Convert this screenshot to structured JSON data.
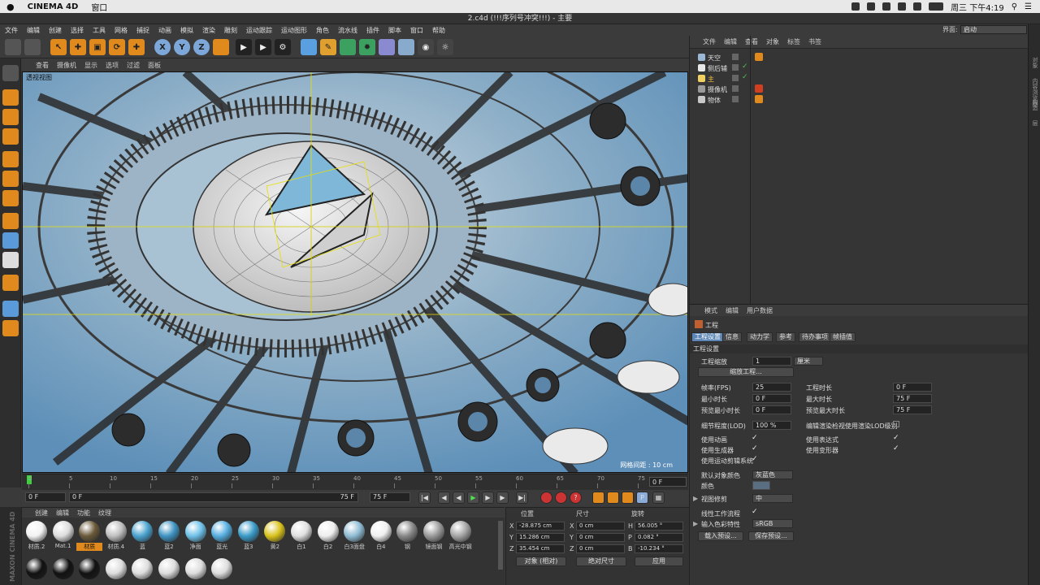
{
  "mac": {
    "app": "CINEMA 4D",
    "menu1": "窗口",
    "clock": "周三 下午4:19"
  },
  "window_title": "2.c4d (!!!序列号冲突!!!) - 主要",
  "menubar": [
    "文件",
    "编辑",
    "创建",
    "选择",
    "工具",
    "网格",
    "捕捉",
    "动画",
    "模拟",
    "渲染",
    "雕刻",
    "运动跟踪",
    "运动图形",
    "角色",
    "流水线",
    "插件",
    "脚本",
    "窗口",
    "帮助"
  ],
  "layout": {
    "label": "界面:",
    "value": "启动"
  },
  "viewport": {
    "menu": [
      "查看",
      "摄像机",
      "显示",
      "选项",
      "过滤",
      "面板"
    ],
    "label": "透视视图",
    "grid": "网格间距 : 10 cm"
  },
  "timeline": {
    "ticks": [
      "0",
      "5",
      "10",
      "15",
      "20",
      "25",
      "30",
      "35",
      "40",
      "45",
      "50",
      "55",
      "60",
      "65",
      "70",
      "75"
    ],
    "frame": "0 F"
  },
  "transport": {
    "start": "0 F",
    "slider": "0 F",
    "slider_end": "75 F",
    "end": "75 F"
  },
  "materials": {
    "menu": [
      "创建",
      "编辑",
      "功能",
      "纹理"
    ],
    "items": [
      {
        "name": "材质.2",
        "color": "#f2f2f2"
      },
      {
        "name": "Mat.1",
        "color": "#dddddd"
      },
      {
        "name": "材质",
        "color": "#6a5a3a"
      },
      {
        "name": "材质.4",
        "color": "#bfbfbf"
      },
      {
        "name": "蓝",
        "color": "#4aa3cf"
      },
      {
        "name": "蓝2",
        "color": "#3f93c2"
      },
      {
        "name": "净面",
        "color": "#6ec0e8"
      },
      {
        "name": "蓝光",
        "color": "#55aee0"
      },
      {
        "name": "蓝3",
        "color": "#3a9bc8"
      },
      {
        "name": "黄2",
        "color": "#d9c21c"
      },
      {
        "name": "白1",
        "color": "#e0e0e0"
      },
      {
        "name": "白2",
        "color": "#eeeeee"
      },
      {
        "name": "白3面盘",
        "color": "#8fbcd4"
      },
      {
        "name": "白4",
        "color": "#f0f0f0"
      },
      {
        "name": "钢",
        "color": "#888888"
      },
      {
        "name": "镜面钢",
        "color": "#9a9a9a"
      },
      {
        "name": "高光中钢",
        "color": "#a5a5a5"
      }
    ]
  },
  "coord": {
    "headers": [
      "位置",
      "尺寸",
      "旋转"
    ],
    "pos": {
      "x": "-28.875 cm",
      "y": "15.286 cm",
      "z": "35.454 cm"
    },
    "size": {
      "x": "0 cm",
      "y": "0 cm",
      "z": "0 cm"
    },
    "rot": {
      "h": "56.005 °",
      "p": "0.082 °",
      "b": "-10.234 °"
    },
    "mode": "对象 (相对)",
    "size_mode": "绝对尺寸",
    "apply": "应用"
  },
  "objects": {
    "menu": [
      "文件",
      "编辑",
      "查看",
      "对象",
      "标签",
      "书签"
    ],
    "rows": [
      {
        "name": "天空",
        "color": "#9ab8d4"
      },
      {
        "name": "侧后辅",
        "color": "#e8e8e8"
      },
      {
        "name": "主",
        "color": "#f0d060"
      },
      {
        "name": "摄像机",
        "color": "#9a9a9a"
      },
      {
        "name": "物体",
        "color": "#c8c8c8"
      }
    ]
  },
  "attr": {
    "menu": [
      "模式",
      "编辑",
      "用户数据"
    ],
    "title": "工程",
    "tabs": [
      "工程设置",
      "信息",
      "动力学",
      "参考",
      "待办事项",
      "帧插值"
    ],
    "section": "工程设置",
    "scale_label": "工程缩放",
    "scale_val": "1",
    "scale_unit": "厘米",
    "scale_btn": "缩放工程...",
    "fps_label": "帧率(FPS)",
    "fps": "25",
    "proj_time_label": "工程时长",
    "proj_time": "0 F",
    "min_time_label": "最小时长",
    "min_time": "0 F",
    "max_time_label": "最大时长",
    "max_time": "75 F",
    "prev_min_label": "预览最小时长",
    "prev_min": "0 F",
    "prev_max_label": "预览最大时长",
    "prev_max": "75 F",
    "lod_label": "细节程度(LOD)",
    "lod": "100 %",
    "lod_render_label": "编辑渲染检视使用渲染LOD级别",
    "anim_label": "使用动画",
    "expr_label": "使用表达式",
    "gen_label": "使用生成器",
    "deform_label": "使用变形器",
    "motion_label": "使用运动剪辑系统",
    "defcolor_label": "默认对象颜色",
    "defcolor": "灰蓝色",
    "color_label": "颜色",
    "clip_label": "视图修剪",
    "clip": "中",
    "linear_label": "线性工作流程",
    "colorprofile_label": "输入色彩特性",
    "colorprofile": "sRGB",
    "load_btn": "载入预设...",
    "save_btn": "保存预设..."
  },
  "rightstrip": [
    "对象",
    "内容浏览器",
    "构造",
    "层"
  ]
}
